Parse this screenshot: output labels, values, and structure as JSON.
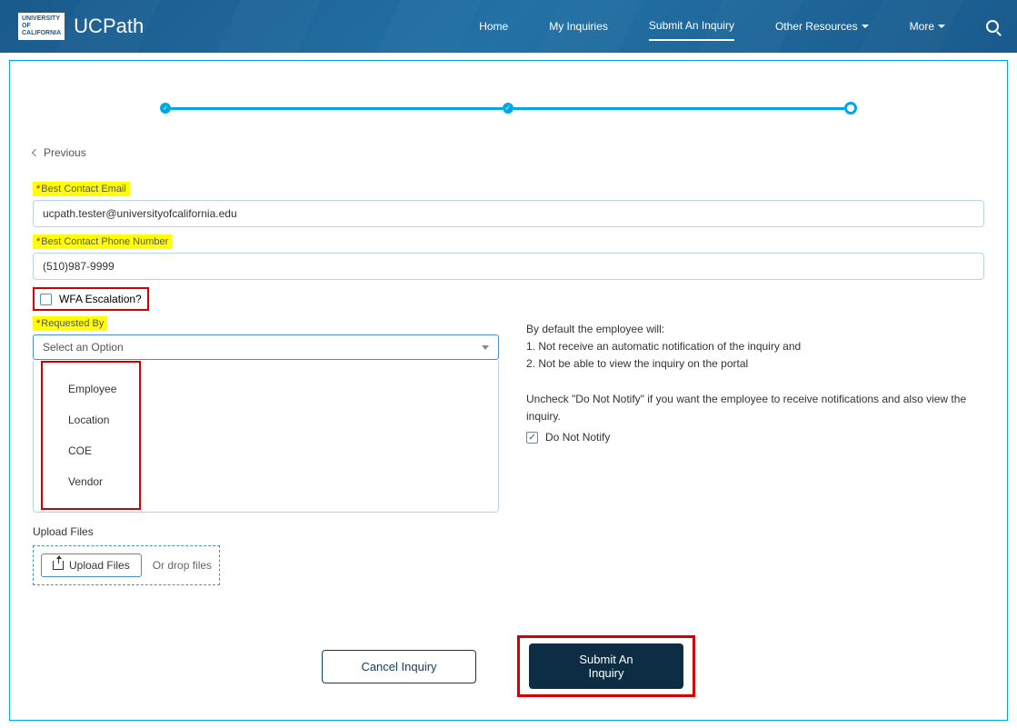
{
  "header": {
    "logo_lines": "UNIVERSITY\nOF\nCALIFORNIA",
    "site_name": "UCPath",
    "nav": {
      "home": "Home",
      "my_inquiries": "My Inquiries",
      "submit_inquiry": "Submit An Inquiry",
      "other_resources": "Other Resources",
      "more": "More"
    }
  },
  "back_link": "Previous",
  "form": {
    "email_label": "Best Contact Email",
    "email_value": "ucpath.tester@universityofcalifornia.edu",
    "phone_label": "Best Contact Phone Number",
    "phone_value": "(510)987-9999",
    "wfa_label": "WFA Escalation?",
    "requested_by_label": "Requested By",
    "requested_by_placeholder": "Select an Option",
    "requested_by_options": [
      "Employee",
      "Location",
      "COE",
      "Vendor"
    ]
  },
  "info": {
    "line1": "By default the employee will:",
    "line2": "1. Not receive an automatic notification of the inquiry and",
    "line3": "2. Not be able to view the inquiry on the portal",
    "uncheck_text": "Uncheck \"Do Not Notify\" if you want the employee to receive notifications and also view the inquiry.",
    "do_not_notify": "Do Not Notify"
  },
  "upload": {
    "section_label": "Upload Files",
    "button_label": "Upload Files",
    "drop_text": "Or drop files"
  },
  "buttons": {
    "cancel": "Cancel Inquiry",
    "submit": "Submit An Inquiry"
  }
}
